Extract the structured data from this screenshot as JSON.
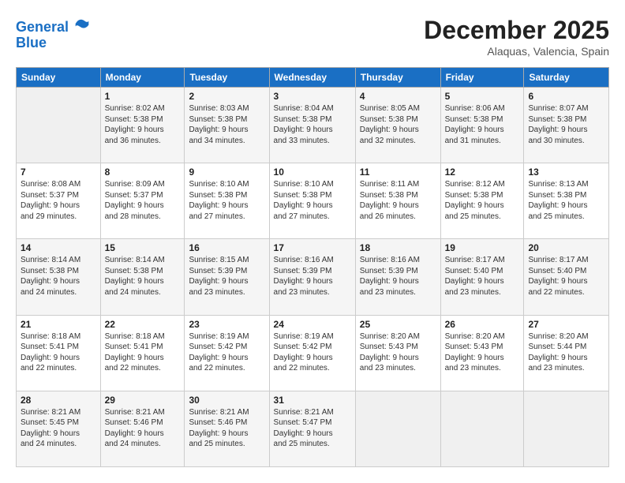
{
  "header": {
    "logo_line1": "General",
    "logo_line2": "Blue",
    "month_title": "December 2025",
    "location": "Alaquas, Valencia, Spain"
  },
  "weekdays": [
    "Sunday",
    "Monday",
    "Tuesday",
    "Wednesday",
    "Thursday",
    "Friday",
    "Saturday"
  ],
  "weeks": [
    [
      {
        "day": "",
        "info": ""
      },
      {
        "day": "1",
        "info": "Sunrise: 8:02 AM\nSunset: 5:38 PM\nDaylight: 9 hours\nand 36 minutes."
      },
      {
        "day": "2",
        "info": "Sunrise: 8:03 AM\nSunset: 5:38 PM\nDaylight: 9 hours\nand 34 minutes."
      },
      {
        "day": "3",
        "info": "Sunrise: 8:04 AM\nSunset: 5:38 PM\nDaylight: 9 hours\nand 33 minutes."
      },
      {
        "day": "4",
        "info": "Sunrise: 8:05 AM\nSunset: 5:38 PM\nDaylight: 9 hours\nand 32 minutes."
      },
      {
        "day": "5",
        "info": "Sunrise: 8:06 AM\nSunset: 5:38 PM\nDaylight: 9 hours\nand 31 minutes."
      },
      {
        "day": "6",
        "info": "Sunrise: 8:07 AM\nSunset: 5:38 PM\nDaylight: 9 hours\nand 30 minutes."
      }
    ],
    [
      {
        "day": "7",
        "info": "Sunrise: 8:08 AM\nSunset: 5:37 PM\nDaylight: 9 hours\nand 29 minutes."
      },
      {
        "day": "8",
        "info": "Sunrise: 8:09 AM\nSunset: 5:37 PM\nDaylight: 9 hours\nand 28 minutes."
      },
      {
        "day": "9",
        "info": "Sunrise: 8:10 AM\nSunset: 5:38 PM\nDaylight: 9 hours\nand 27 minutes."
      },
      {
        "day": "10",
        "info": "Sunrise: 8:10 AM\nSunset: 5:38 PM\nDaylight: 9 hours\nand 27 minutes."
      },
      {
        "day": "11",
        "info": "Sunrise: 8:11 AM\nSunset: 5:38 PM\nDaylight: 9 hours\nand 26 minutes."
      },
      {
        "day": "12",
        "info": "Sunrise: 8:12 AM\nSunset: 5:38 PM\nDaylight: 9 hours\nand 25 minutes."
      },
      {
        "day": "13",
        "info": "Sunrise: 8:13 AM\nSunset: 5:38 PM\nDaylight: 9 hours\nand 25 minutes."
      }
    ],
    [
      {
        "day": "14",
        "info": "Sunrise: 8:14 AM\nSunset: 5:38 PM\nDaylight: 9 hours\nand 24 minutes."
      },
      {
        "day": "15",
        "info": "Sunrise: 8:14 AM\nSunset: 5:38 PM\nDaylight: 9 hours\nand 24 minutes."
      },
      {
        "day": "16",
        "info": "Sunrise: 8:15 AM\nSunset: 5:39 PM\nDaylight: 9 hours\nand 23 minutes."
      },
      {
        "day": "17",
        "info": "Sunrise: 8:16 AM\nSunset: 5:39 PM\nDaylight: 9 hours\nand 23 minutes."
      },
      {
        "day": "18",
        "info": "Sunrise: 8:16 AM\nSunset: 5:39 PM\nDaylight: 9 hours\nand 23 minutes."
      },
      {
        "day": "19",
        "info": "Sunrise: 8:17 AM\nSunset: 5:40 PM\nDaylight: 9 hours\nand 23 minutes."
      },
      {
        "day": "20",
        "info": "Sunrise: 8:17 AM\nSunset: 5:40 PM\nDaylight: 9 hours\nand 22 minutes."
      }
    ],
    [
      {
        "day": "21",
        "info": "Sunrise: 8:18 AM\nSunset: 5:41 PM\nDaylight: 9 hours\nand 22 minutes."
      },
      {
        "day": "22",
        "info": "Sunrise: 8:18 AM\nSunset: 5:41 PM\nDaylight: 9 hours\nand 22 minutes."
      },
      {
        "day": "23",
        "info": "Sunrise: 8:19 AM\nSunset: 5:42 PM\nDaylight: 9 hours\nand 22 minutes."
      },
      {
        "day": "24",
        "info": "Sunrise: 8:19 AM\nSunset: 5:42 PM\nDaylight: 9 hours\nand 22 minutes."
      },
      {
        "day": "25",
        "info": "Sunrise: 8:20 AM\nSunset: 5:43 PM\nDaylight: 9 hours\nand 23 minutes."
      },
      {
        "day": "26",
        "info": "Sunrise: 8:20 AM\nSunset: 5:43 PM\nDaylight: 9 hours\nand 23 minutes."
      },
      {
        "day": "27",
        "info": "Sunrise: 8:20 AM\nSunset: 5:44 PM\nDaylight: 9 hours\nand 23 minutes."
      }
    ],
    [
      {
        "day": "28",
        "info": "Sunrise: 8:21 AM\nSunset: 5:45 PM\nDaylight: 9 hours\nand 24 minutes."
      },
      {
        "day": "29",
        "info": "Sunrise: 8:21 AM\nSunset: 5:46 PM\nDaylight: 9 hours\nand 24 minutes."
      },
      {
        "day": "30",
        "info": "Sunrise: 8:21 AM\nSunset: 5:46 PM\nDaylight: 9 hours\nand 25 minutes."
      },
      {
        "day": "31",
        "info": "Sunrise: 8:21 AM\nSunset: 5:47 PM\nDaylight: 9 hours\nand 25 minutes."
      },
      {
        "day": "",
        "info": ""
      },
      {
        "day": "",
        "info": ""
      },
      {
        "day": "",
        "info": ""
      }
    ]
  ]
}
